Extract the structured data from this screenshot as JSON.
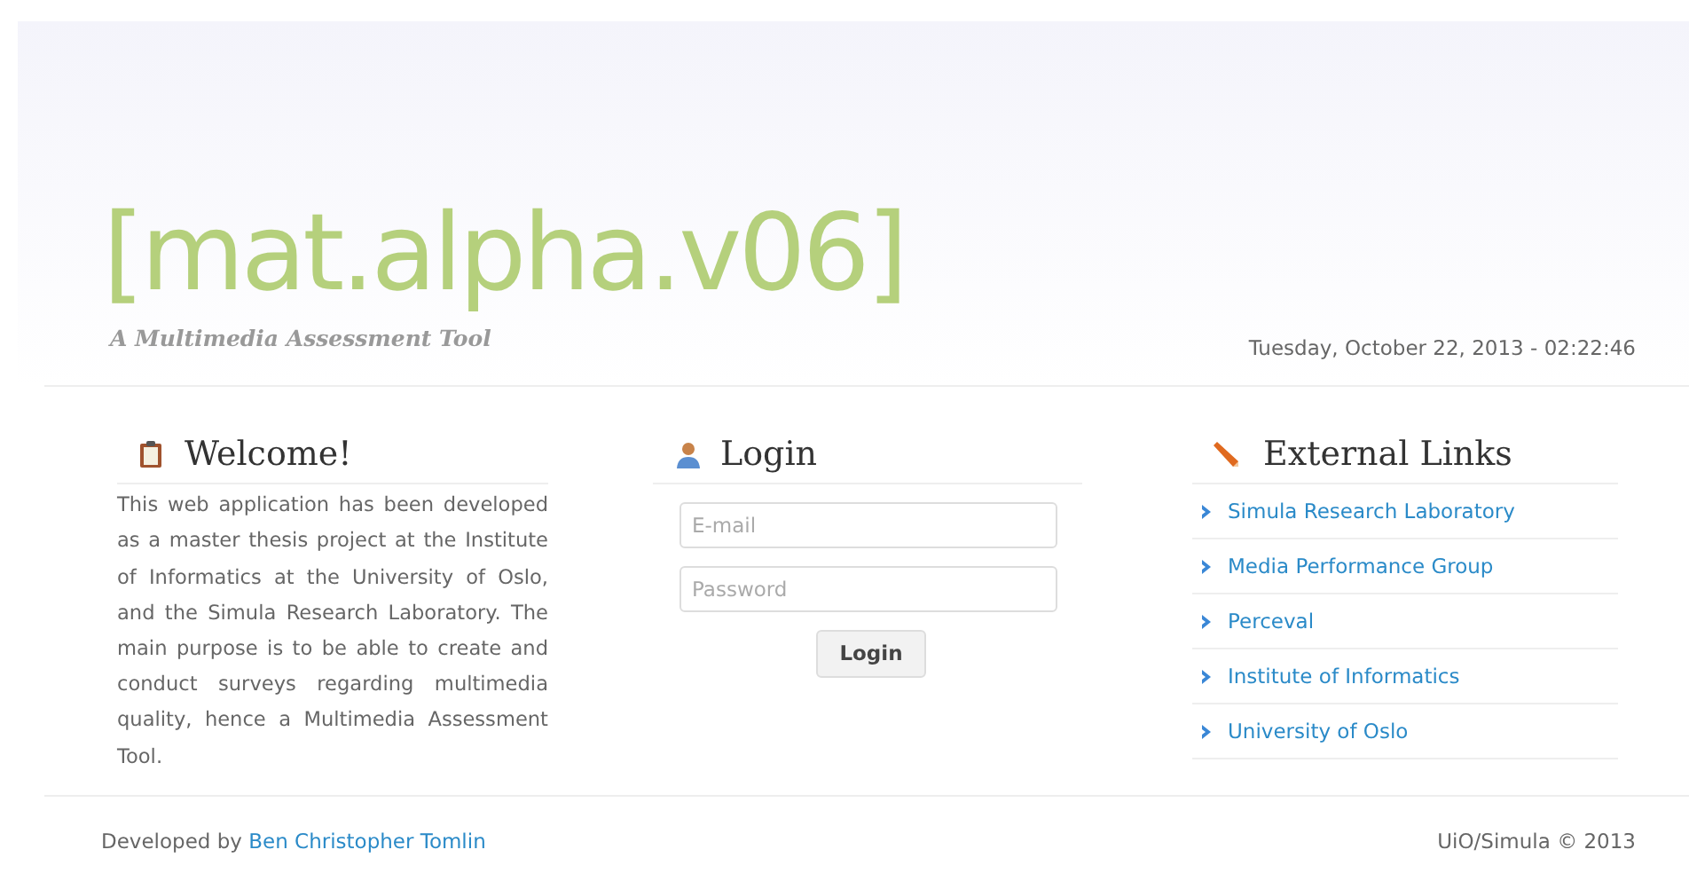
{
  "header": {
    "logo": "[mat.alpha.v06]",
    "tagline": "A Multimedia Assessment Tool",
    "datetime": "Tuesday, October 22, 2013 - 02:22:46"
  },
  "welcome": {
    "title": "Welcome!",
    "text": "This web application has been developed as a master thesis project at the Institute of Informatics at the University of Oslo, and the Simula Research Laboratory. The main purpose is to be able to create and conduct surveys regarding multimedia quality, hence a Multimedia Assessment Tool."
  },
  "login": {
    "title": "Login",
    "fields": [
      {
        "placeholder": "E-mail"
      },
      {
        "placeholder": "Password"
      }
    ],
    "button": "Login"
  },
  "external_links": {
    "title": "External Links",
    "links": [
      {
        "label": "Simula Research Laboratory"
      },
      {
        "label": "Media Performance Group"
      },
      {
        "label": "Perceval"
      },
      {
        "label": "Institute of Informatics"
      },
      {
        "label": "University of Oslo"
      }
    ]
  },
  "footer": {
    "credit_prefix": "Developed by",
    "credit_link": "Ben Christopher Tomlin",
    "copyright": "UiO/Simula © 2013"
  }
}
